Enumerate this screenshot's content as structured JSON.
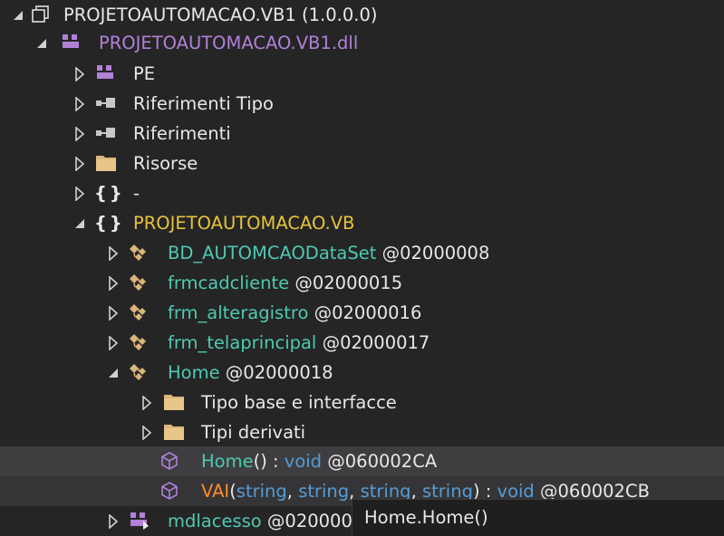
{
  "tree": {
    "root": {
      "label": "PROJETOAUTOMACAO.VB1 (1.0.0.0)"
    },
    "module": {
      "label": "PROJETOAUTOMACAO.VB1.dll"
    },
    "pe": {
      "label": "PE"
    },
    "type_refs": {
      "label": "Riferimenti Tipo"
    },
    "refs": {
      "label": "Riferimenti"
    },
    "resources": {
      "label": "Risorse"
    },
    "empty_ns": {
      "label": "-"
    },
    "namespace": {
      "label": "PROJETOAUTOMACAO.VB"
    },
    "types": [
      {
        "name": "BD_AUTOMCAODataSet",
        "token": "@02000008"
      },
      {
        "name": "frmcadcliente",
        "token": "@02000015"
      },
      {
        "name": "frm_alteragistro",
        "token": "@02000016"
      },
      {
        "name": "frm_telaprincipal",
        "token": "@02000017"
      }
    ],
    "home": {
      "name": "Home",
      "token": "@02000018"
    },
    "base_types": {
      "label": "Tipo base e interfacce"
    },
    "derived_types": {
      "label": "Tipi derivati"
    },
    "ctor": {
      "name": "Home",
      "params": "()",
      "sep": " : ",
      "ret": "void",
      "token": "@060002CA"
    },
    "vai": {
      "name": "VAI",
      "open": "(",
      "p1": "string",
      "c1": ", ",
      "p2": "string",
      "c2": ", ",
      "p3": "string",
      "c3": ", ",
      "p4": "string",
      "close": ")",
      "sep": " : ",
      "ret": "void",
      "token": "@060002CB"
    },
    "mdlacesso": {
      "name": "mdlacesso",
      "token": "@020000"
    }
  },
  "tooltip": {
    "text": "Home.Home()"
  },
  "colors": {
    "background": "#252526",
    "selected_row": "#3e3e40",
    "namespace": "#e6c33b",
    "type": "#4ec9b0",
    "keyword": "#569cd6",
    "method": "#ff8c28",
    "module": "#b180d7"
  }
}
